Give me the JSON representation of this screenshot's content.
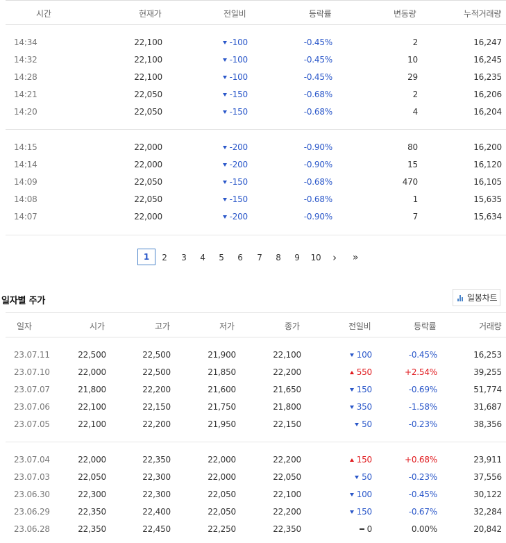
{
  "time_table": {
    "headers": [
      "시간",
      "현재가",
      "전일비",
      "등락률",
      "변동량",
      "누적거래량"
    ],
    "groups": [
      [
        {
          "time": "14:34",
          "price": "22,100",
          "change": "-100",
          "dir": "down",
          "rate": "-0.45%",
          "vol": "2",
          "cum": "16,247"
        },
        {
          "time": "14:32",
          "price": "22,100",
          "change": "-100",
          "dir": "down",
          "rate": "-0.45%",
          "vol": "10",
          "cum": "16,245"
        },
        {
          "time": "14:28",
          "price": "22,100",
          "change": "-100",
          "dir": "down",
          "rate": "-0.45%",
          "vol": "29",
          "cum": "16,235"
        },
        {
          "time": "14:21",
          "price": "22,050",
          "change": "-150",
          "dir": "down",
          "rate": "-0.68%",
          "vol": "2",
          "cum": "16,206"
        },
        {
          "time": "14:20",
          "price": "22,050",
          "change": "-150",
          "dir": "down",
          "rate": "-0.68%",
          "vol": "4",
          "cum": "16,204"
        }
      ],
      [
        {
          "time": "14:15",
          "price": "22,000",
          "change": "-200",
          "dir": "down",
          "rate": "-0.90%",
          "vol": "80",
          "cum": "16,200"
        },
        {
          "time": "14:14",
          "price": "22,000",
          "change": "-200",
          "dir": "down",
          "rate": "-0.90%",
          "vol": "15",
          "cum": "16,120"
        },
        {
          "time": "14:09",
          "price": "22,050",
          "change": "-150",
          "dir": "down",
          "rate": "-0.68%",
          "vol": "470",
          "cum": "16,105"
        },
        {
          "time": "14:08",
          "price": "22,050",
          "change": "-150",
          "dir": "down",
          "rate": "-0.68%",
          "vol": "1",
          "cum": "15,635"
        },
        {
          "time": "14:07",
          "price": "22,000",
          "change": "-200",
          "dir": "down",
          "rate": "-0.90%",
          "vol": "7",
          "cum": "15,634"
        }
      ]
    ]
  },
  "pagination": {
    "pages": [
      "1",
      "2",
      "3",
      "4",
      "5",
      "6",
      "7",
      "8",
      "9",
      "10"
    ],
    "current": "1",
    "next": "›",
    "last": "»"
  },
  "daily": {
    "title": "일자별 주가",
    "chart_button": "일봉차트",
    "headers": [
      "일자",
      "시가",
      "고가",
      "저가",
      "종가",
      "전일비",
      "등락률",
      "거래량"
    ],
    "groups": [
      [
        {
          "date": "23.07.11",
          "open": "22,500",
          "high": "22,500",
          "low": "21,900",
          "close": "22,100",
          "change": "100",
          "dir": "down",
          "rate": "-0.45%",
          "vol": "16,253"
        },
        {
          "date": "23.07.10",
          "open": "22,000",
          "high": "22,500",
          "low": "21,850",
          "close": "22,200",
          "change": "550",
          "dir": "up",
          "rate": "+2.54%",
          "vol": "39,255"
        },
        {
          "date": "23.07.07",
          "open": "21,800",
          "high": "22,200",
          "low": "21,600",
          "close": "21,650",
          "change": "150",
          "dir": "down",
          "rate": "-0.69%",
          "vol": "51,774"
        },
        {
          "date": "23.07.06",
          "open": "22,100",
          "high": "22,150",
          "low": "21,750",
          "close": "21,800",
          "change": "350",
          "dir": "down",
          "rate": "-1.58%",
          "vol": "31,687"
        },
        {
          "date": "23.07.05",
          "open": "22,100",
          "high": "22,200",
          "low": "21,950",
          "close": "22,150",
          "change": "50",
          "dir": "down",
          "rate": "-0.23%",
          "vol": "38,356"
        }
      ],
      [
        {
          "date": "23.07.04",
          "open": "22,000",
          "high": "22,350",
          "low": "22,000",
          "close": "22,200",
          "change": "150",
          "dir": "up",
          "rate": "+0.68%",
          "vol": "23,911"
        },
        {
          "date": "23.07.03",
          "open": "22,050",
          "high": "22,300",
          "low": "22,000",
          "close": "22,050",
          "change": "50",
          "dir": "down",
          "rate": "-0.23%",
          "vol": "37,556"
        },
        {
          "date": "23.06.30",
          "open": "22,300",
          "high": "22,300",
          "low": "22,050",
          "close": "22,100",
          "change": "100",
          "dir": "down",
          "rate": "-0.45%",
          "vol": "30,122"
        },
        {
          "date": "23.06.29",
          "open": "22,350",
          "high": "22,400",
          "low": "22,050",
          "close": "22,200",
          "change": "150",
          "dir": "down",
          "rate": "-0.67%",
          "vol": "32,284"
        },
        {
          "date": "23.06.28",
          "open": "22,350",
          "high": "22,450",
          "low": "22,250",
          "close": "22,350",
          "change": "0",
          "dir": "flat",
          "rate": "0.00%",
          "vol": "20,842"
        }
      ]
    ]
  },
  "colors": {
    "up": "#e0191d",
    "down": "#2a57c9",
    "border": "#dddddd"
  }
}
